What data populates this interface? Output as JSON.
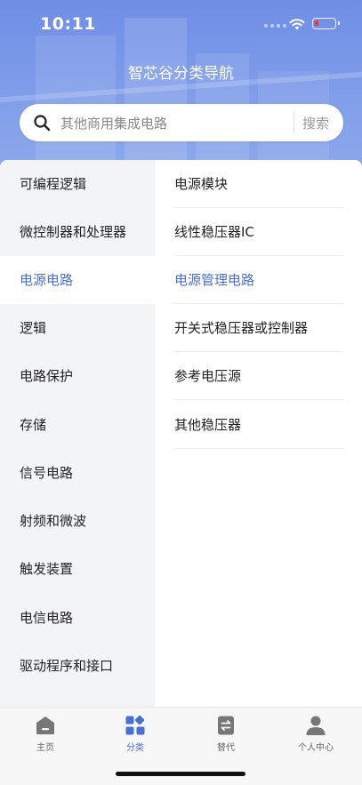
{
  "status_bar": {
    "time": "10:11"
  },
  "header": {
    "title": "智芯谷分类导航"
  },
  "search": {
    "placeholder": "其他商用集成电路",
    "button_label": "搜索"
  },
  "left_menu": [
    {
      "label": "可编程逻辑",
      "active": false
    },
    {
      "label": "微控制器和处理器",
      "active": false
    },
    {
      "label": "电源电路",
      "active": true
    },
    {
      "label": "逻辑",
      "active": false
    },
    {
      "label": "电路保护",
      "active": false
    },
    {
      "label": "存储",
      "active": false
    },
    {
      "label": "信号电路",
      "active": false
    },
    {
      "label": "射频和微波",
      "active": false
    },
    {
      "label": "触发装置",
      "active": false
    },
    {
      "label": "电信电路",
      "active": false
    },
    {
      "label": "驱动程序和接口",
      "active": false
    }
  ],
  "right_menu": [
    {
      "label": "电源模块",
      "active": false
    },
    {
      "label": "线性稳压器IC",
      "active": false
    },
    {
      "label": "电源管理电路",
      "active": true
    },
    {
      "label": "开关式稳压器或控制器",
      "active": false
    },
    {
      "label": "参考电压源",
      "active": false
    },
    {
      "label": "其他稳压器",
      "active": false
    }
  ],
  "tabbar": {
    "items": [
      {
        "label": "主页",
        "icon": "home-icon",
        "active": false
      },
      {
        "label": "分类",
        "icon": "category-icon",
        "active": true
      },
      {
        "label": "替代",
        "icon": "swap-icon",
        "active": false
      },
      {
        "label": "个人中心",
        "icon": "user-icon",
        "active": false
      }
    ]
  },
  "colors": {
    "accent": "#4a6fd4",
    "header_bg": "#7592e7",
    "battery_low": "#e8383d"
  }
}
